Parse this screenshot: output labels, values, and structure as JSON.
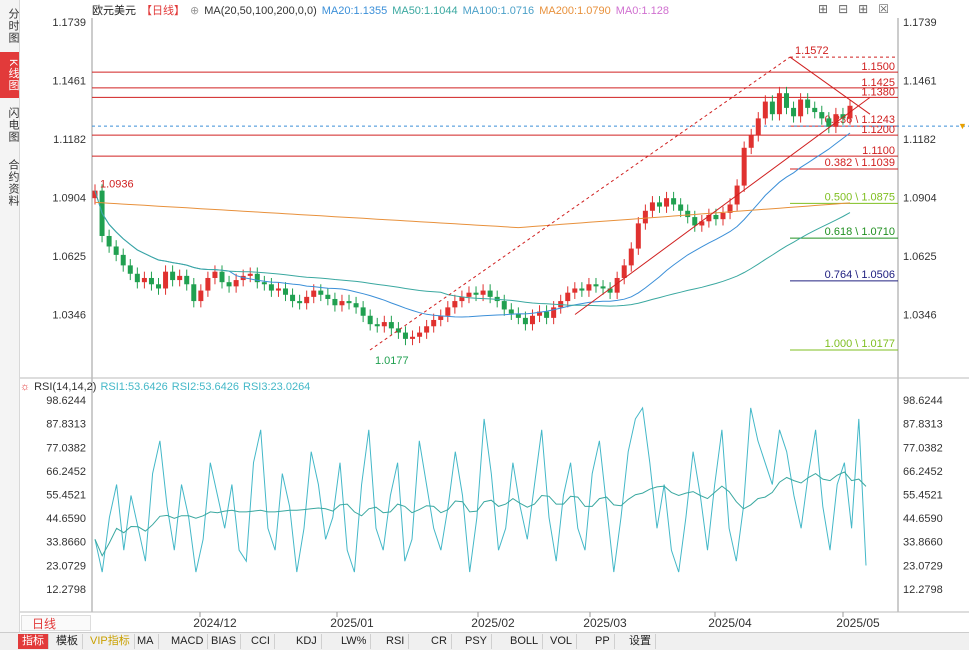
{
  "left_tabs": [
    {
      "label": "分时图",
      "active": false
    },
    {
      "label": "K线图",
      "active": true
    },
    {
      "label": "闪电图",
      "active": false
    },
    {
      "label": "合约资料",
      "active": false
    }
  ],
  "header": {
    "symbol": "欧元美元",
    "period": "【日线】",
    "ma_params": "MA(20,50,100,200,0,0)",
    "ma20": "MA20:1.1355",
    "ma50": "MA50:1.1044",
    "ma100": "MA100:1.0716",
    "ma200": "MA200:1.0790",
    "ma0": "MA0:1.128"
  },
  "colors": {
    "up": "#e0312f",
    "down": "#20a050",
    "ma20": "#3b8fd8",
    "ma50": "#3aa8a0",
    "ma100": "#4aa0c8",
    "ma200": "#e8913c",
    "fib": "#d02020",
    "rsi": "#44b8c8"
  },
  "price_axis": [
    "1.1739",
    "1.1461",
    "1.1182",
    "1.0904",
    "1.0625",
    "1.0346"
  ],
  "annotations": {
    "high": "1.1572",
    "low": "1.0177",
    "start": "1.0936",
    "levels": [
      "1.1500",
      "1.1425",
      "1.1380",
      "1.1200",
      "1.1100"
    ],
    "fib": [
      "0.236 \\ 1.1243",
      "0.382 \\ 1.1039",
      "0.500 \\ 1.0875",
      "0.618 \\ 1.0710",
      "0.764 \\ 1.0506",
      "1.000 \\ 1.0177"
    ]
  },
  "rsi": {
    "title": "RSI(14,14,2)",
    "rsi1": "RSI1:53.6426",
    "rsi2": "RSI2:53.6426",
    "rsi3": "RSI3:23.0264",
    "axis": [
      "98.6244",
      "87.8313",
      "77.0382",
      "66.2452",
      "55.4521",
      "44.6590",
      "33.8660",
      "23.0729",
      "12.2798"
    ]
  },
  "time_axis": [
    "2024/12",
    "2025/01",
    "2025/02",
    "2025/03",
    "2025/04",
    "2025/05"
  ],
  "period_button": "日线",
  "bottom_bar": [
    "指标",
    "模板",
    "VIP指标",
    "MA",
    "MACD",
    "BIAS",
    "CCI",
    "KDJ",
    "LW%",
    "RSI",
    "CR",
    "PSY",
    "BOLL",
    "VOL",
    "PP",
    "设置"
  ],
  "chart_data": {
    "type": "candlestick",
    "title": "欧元美元【日线】",
    "ylim": [
      1.0177,
      1.1739
    ],
    "series_close": [
      1.0936,
      1.072,
      1.067,
      1.063,
      1.058,
      1.054,
      1.05,
      1.052,
      1.049,
      1.047,
      1.055,
      1.051,
      1.053,
      1.049,
      1.041,
      1.046,
      1.052,
      1.055,
      1.05,
      1.048,
      1.051,
      1.053,
      1.054,
      1.05,
      1.049,
      1.046,
      1.047,
      1.044,
      1.041,
      1.04,
      1.043,
      1.046,
      1.044,
      1.042,
      1.039,
      1.041,
      1.04,
      1.038,
      1.034,
      1.03,
      1.029,
      1.031,
      1.028,
      1.026,
      1.023,
      1.024,
      1.026,
      1.029,
      1.032,
      1.034,
      1.038,
      1.041,
      1.043,
      1.045,
      1.044,
      1.046,
      1.043,
      1.041,
      1.037,
      1.035,
      1.033,
      1.03,
      1.034,
      1.036,
      1.033,
      1.038,
      1.041,
      1.045,
      1.047,
      1.046,
      1.049,
      1.048,
      1.047,
      1.045,
      1.052,
      1.058,
      1.066,
      1.078,
      1.084,
      1.088,
      1.086,
      1.09,
      1.087,
      1.084,
      1.081,
      1.077,
      1.079,
      1.082,
      1.08,
      1.083,
      1.087,
      1.096,
      1.114,
      1.12,
      1.128,
      1.136,
      1.13,
      1.14,
      1.133,
      1.129,
      1.137,
      1.133,
      1.131,
      1.128,
      1.124,
      1.13,
      1.128,
      1.134
    ],
    "rsi_values": [
      35,
      20,
      45,
      60,
      30,
      55,
      40,
      25,
      65,
      80,
      50,
      30,
      60,
      45,
      20,
      35,
      70,
      55,
      40,
      60,
      30,
      25,
      70,
      85,
      40,
      30,
      65,
      50,
      20,
      40,
      75,
      60,
      35,
      45,
      70,
      30,
      20,
      60,
      85,
      40,
      30,
      55,
      70,
      25,
      35,
      80,
      60,
      40,
      30,
      50,
      75,
      55,
      20,
      45,
      90,
      65,
      30,
      40,
      70,
      50,
      35,
      60,
      85,
      45,
      25,
      55,
      70,
      40,
      30,
      65,
      80,
      50,
      20,
      45,
      75,
      90,
      95,
      70,
      40,
      60,
      30,
      20,
      45,
      75,
      55,
      30,
      60,
      85,
      40,
      25,
      50,
      95,
      80,
      70,
      60,
      85,
      75,
      55,
      40,
      65,
      85,
      50,
      30,
      60,
      70,
      40,
      90,
      23
    ]
  }
}
